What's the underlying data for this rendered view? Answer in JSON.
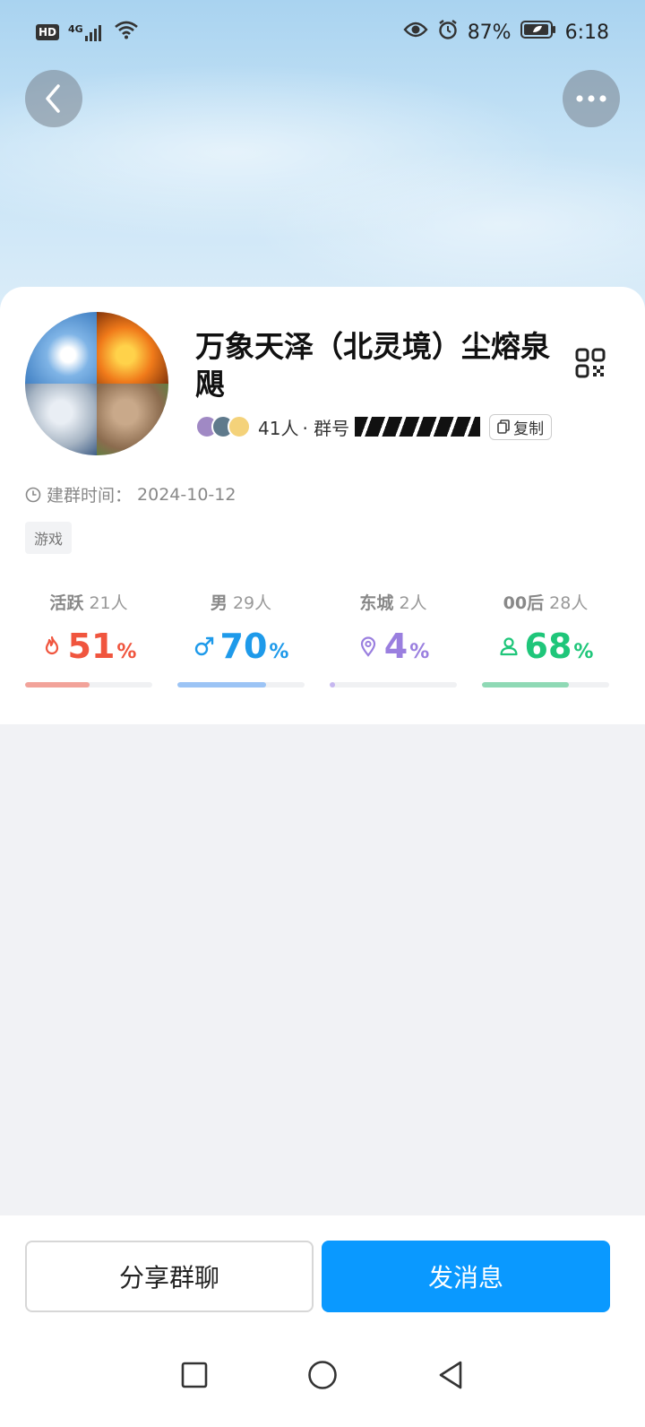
{
  "status_bar": {
    "hd": "HD",
    "network": "4G",
    "battery": "87%",
    "time": "6:18"
  },
  "group": {
    "name": "万象天泽（北灵境）尘熔泉飓",
    "member_count": "41人",
    "group_no_label": "· 群号",
    "copy_label": "复制",
    "created_label": "建群时间：",
    "created_date": "2024-10-12",
    "tag": "游戏"
  },
  "stats": [
    {
      "label": "活跃",
      "count": "21人",
      "value": "51",
      "unit": "%",
      "percent": 51,
      "color": "#f0553e",
      "bar_color": "#f2a39a",
      "icon": "flame-icon"
    },
    {
      "label": "男",
      "count": "29人",
      "value": "70",
      "unit": "%",
      "percent": 70,
      "color": "#1e9aea",
      "bar_color": "#9cc4f5",
      "icon": "male-icon"
    },
    {
      "label": "东城",
      "count": "2人",
      "value": "4",
      "unit": "%",
      "percent": 4,
      "color": "#9a7fdf",
      "bar_color": "#c6b7f0",
      "icon": "location-pin-icon"
    },
    {
      "label": "00后",
      "count": "28人",
      "value": "68",
      "unit": "%",
      "percent": 68,
      "color": "#1fc67a",
      "bar_color": "#8fd9b5",
      "icon": "person-icon"
    }
  ],
  "actions": {
    "share": "分享群聊",
    "send": "发消息"
  }
}
